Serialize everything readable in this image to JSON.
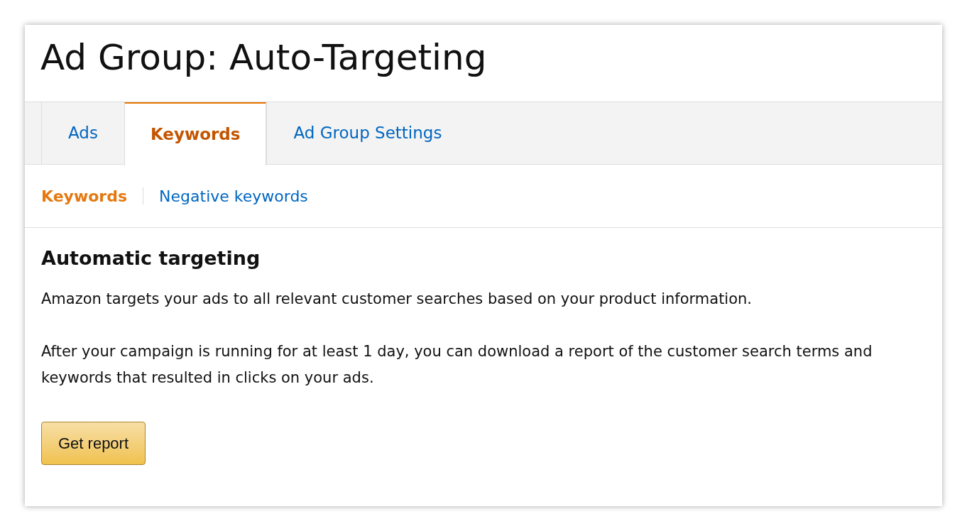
{
  "title": "Ad Group: Auto-Targeting",
  "tabs": [
    {
      "label": "Ads",
      "selected": false
    },
    {
      "label": "Keywords",
      "selected": true
    },
    {
      "label": "Ad Group Settings",
      "selected": false
    }
  ],
  "subtabs": [
    {
      "label": "Keywords",
      "selected": true
    },
    {
      "label": "Negative keywords",
      "selected": false
    }
  ],
  "section": {
    "heading": "Automatic targeting",
    "paragraphs": [
      "Amazon targets your ads to all relevant customer searches based on your product information.",
      "After your campaign is running for at least 1 day, you can download a report of the customer search terms and keywords that resulted in clicks on your ads."
    ],
    "button": "Get report"
  }
}
